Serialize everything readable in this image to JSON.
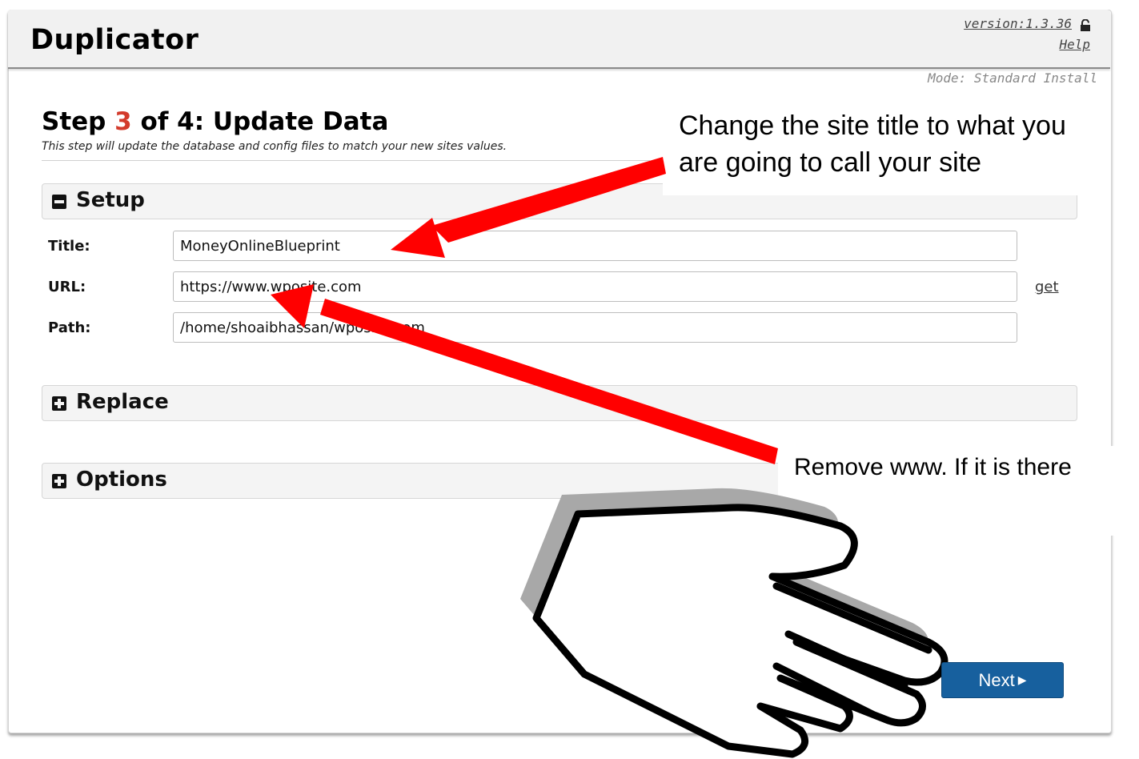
{
  "app": {
    "title": "Duplicator",
    "version": "version:1.3.36",
    "help": "Help",
    "mode": "Mode: Standard Install"
  },
  "step": {
    "label": "Step",
    "number": "3",
    "rest": "of 4: Update Data",
    "subtitle": "This step will update the database and config files to match your new sites values."
  },
  "panels": {
    "setup": "Setup",
    "replace": "Replace",
    "options": "Options"
  },
  "fields": {
    "title_label": "Title:",
    "title_value": "MoneyOnlineBlueprint",
    "url_label": "URL:",
    "url_value": "https://www.wposite.com",
    "url_get": "get",
    "path_label": "Path:",
    "path_value": "/home/shoaibhassan/wposite.com"
  },
  "annotations": {
    "title_hint": "Change the site title to what you are going to call your site",
    "url_hint": "Remove www. If it is there"
  },
  "buttons": {
    "next": "Next"
  },
  "colors": {
    "accent_step": "#d33b2c",
    "next_button": "#17609e",
    "arrow": "#ff0000"
  },
  "icons": {
    "lock": "lock-icon",
    "setup": "minus-square-icon",
    "replace": "plus-square-icon",
    "options": "plus-square-icon",
    "next": "caret-right-icon",
    "hand": "pointing-hand-icon"
  }
}
